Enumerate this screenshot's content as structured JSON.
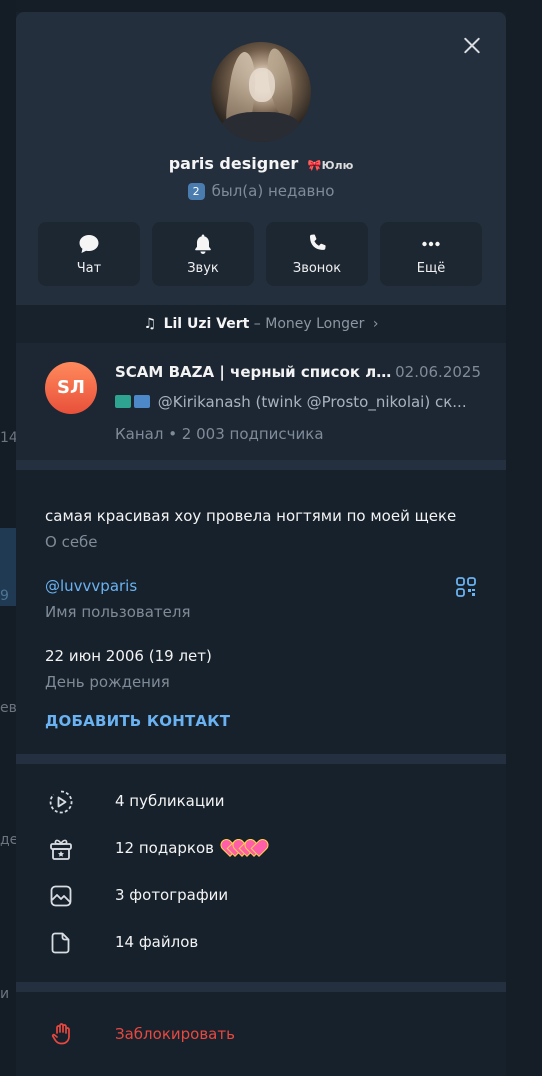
{
  "background": {
    "fragments": [
      "14",
      "9",
      "ев",
      "де",
      "и"
    ]
  },
  "profile": {
    "name": "paris designer",
    "emoji_status_text": "Юлю",
    "badge": "2",
    "last_seen": "был(а) недавно"
  },
  "actions": [
    {
      "label": "Чат",
      "icon": "chat-bubble-icon"
    },
    {
      "label": "Звук",
      "icon": "bell-icon"
    },
    {
      "label": "Звонок",
      "icon": "phone-icon"
    },
    {
      "label": "Ещё",
      "icon": "more-dots-icon"
    }
  ],
  "music": {
    "note": "♫",
    "artist": "Lil Uzi Vert",
    "separator": "–",
    "title": "Money Longer",
    "chevron": "›"
  },
  "channel": {
    "avatar_initials": "SЛ",
    "name": "SCAM BAZA | черный список лол...",
    "date": "02.06.2025",
    "message": "@Kirikanash (twink @Prosto_nikolai) ск...",
    "meta": "Канал • 2 003 подписчика"
  },
  "info": {
    "bio": "самая красивая хоу провела ногтями по моей щеке",
    "bio_label": "О себе",
    "username": "@luvvvparis",
    "username_label": "Имя пользователя",
    "birthday": "22 июн 2006 (19 лет)",
    "birthday_label": "День рождения",
    "add_contact": "ДОБАВИТЬ КОНТАКТ"
  },
  "media": [
    {
      "label": "4 публикации",
      "icon": "stories-icon"
    },
    {
      "label": "12 подарков",
      "icon": "gift-icon"
    },
    {
      "label": "3 фотографии",
      "icon": "photo-icon"
    },
    {
      "label": "14 файлов",
      "icon": "file-icon"
    }
  ],
  "block": {
    "label": "Заблокировать",
    "icon": "hand-stop-icon"
  },
  "colors": {
    "accent": "#6ab2f2",
    "danger": "#e8483f",
    "panel": "#17212b",
    "header": "#242f3d"
  }
}
